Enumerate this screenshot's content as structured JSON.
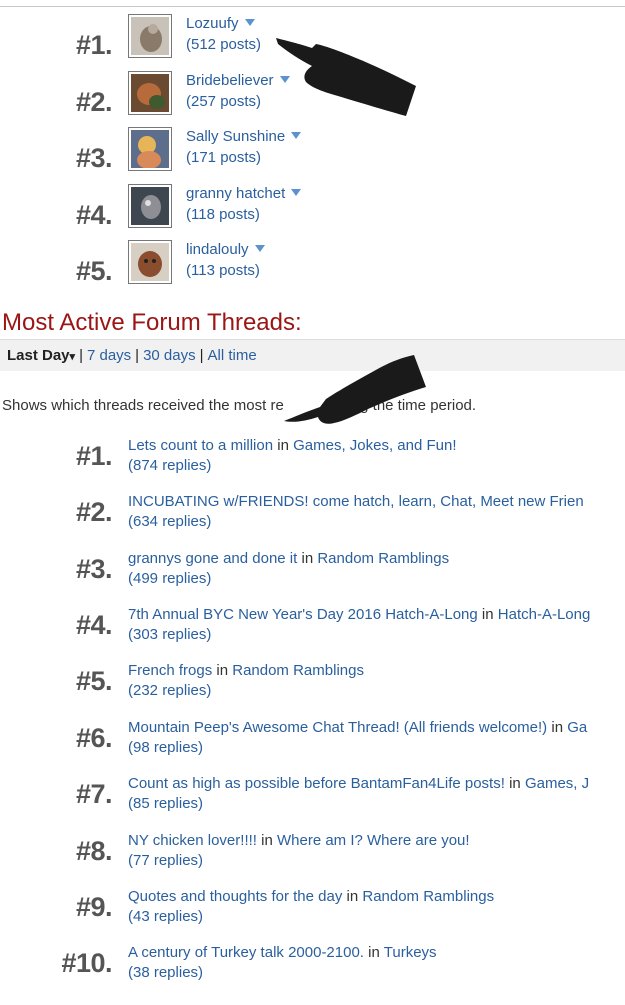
{
  "top_posters": [
    {
      "rank": "#1.",
      "username": "Lozuufy",
      "posts": "(512 posts)",
      "avatar_color": "#8a7a6a"
    },
    {
      "rank": "#2.",
      "username": "Bridebeliever",
      "posts": "(257 posts)",
      "avatar_color": "#a0603a"
    },
    {
      "rank": "#3.",
      "username": "Sally Sunshine",
      "posts": "(171 posts)",
      "avatar_color": "#d9a14a"
    },
    {
      "rank": "#4.",
      "username": "granny hatchet",
      "posts": "(118 posts)",
      "avatar_color": "#5a5a60"
    },
    {
      "rank": "#5.",
      "username": "lindalouly",
      "posts": "(113 posts)",
      "avatar_color": "#7a4a30"
    }
  ],
  "threads_section": {
    "title": "Most Active Forum Threads:",
    "tabs": {
      "active": "Last Day",
      "caret": "▾",
      "links": [
        "7 days",
        "30 days",
        "All time"
      ],
      "separator": "|"
    },
    "description": "Shows which threads received the most re",
    "description_tail": "ng the time period.",
    "in_word": "in",
    "threads": [
      {
        "rank": "#1.",
        "title": "Lets count to a million",
        "forum": "Games, Jokes, and Fun!",
        "replies": "(874 replies)"
      },
      {
        "rank": "#2.",
        "title": "INCUBATING w/FRIENDS! come hatch, learn, Chat, Meet new Frien",
        "forum": "",
        "replies": "(634 replies)"
      },
      {
        "rank": "#3.",
        "title": "grannys gone and done it",
        "forum": "Random Ramblings",
        "replies": "(499 replies)"
      },
      {
        "rank": "#4.",
        "title": "7th Annual BYC New Year's Day 2016 Hatch-A-Long",
        "forum": "Hatch-A-Long",
        "replies": "(303 replies)"
      },
      {
        "rank": "#5.",
        "title": "French frogs",
        "forum": "Random Ramblings",
        "replies": "(232 replies)"
      },
      {
        "rank": "#6.",
        "title": "Mountain Peep's Awesome Chat Thread! (All friends welcome!)",
        "forum": "Ga",
        "replies": "(98 replies)"
      },
      {
        "rank": "#7.",
        "title": "Count as high as possible before BantamFan4Life posts!",
        "forum": "Games, J",
        "replies": "(85 replies)"
      },
      {
        "rank": "#8.",
        "title": "NY chicken lover!!!!",
        "forum": "Where am I? Where are you!",
        "replies": "(77 replies)"
      },
      {
        "rank": "#9.",
        "title": "Quotes and thoughts for the day",
        "forum": "Random Ramblings",
        "replies": "(43 replies)"
      },
      {
        "rank": "#10.",
        "title": "A century of Turkey talk 2000-2100.",
        "forum": "Turkeys",
        "replies": "(38 replies)"
      }
    ]
  },
  "colors": {
    "link": "#2a5f9e",
    "section_title": "#9b1515",
    "rank": "#555555"
  }
}
